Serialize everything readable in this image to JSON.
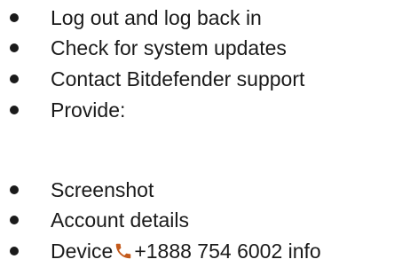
{
  "items": [
    {
      "text": "Log out and log back in"
    },
    {
      "text": "Check for system updates"
    },
    {
      "text": "Contact Bitdefender support"
    },
    {
      "text": "Provide:"
    },
    {
      "text": "Screenshot"
    },
    {
      "text": "Account details"
    },
    {
      "text_before": "Device",
      "icon": "phone-icon",
      "text_after": "+1888 754 6002 info"
    }
  ],
  "colors": {
    "text": "#1a1a1a",
    "phone_icon": "#c45a1c"
  }
}
